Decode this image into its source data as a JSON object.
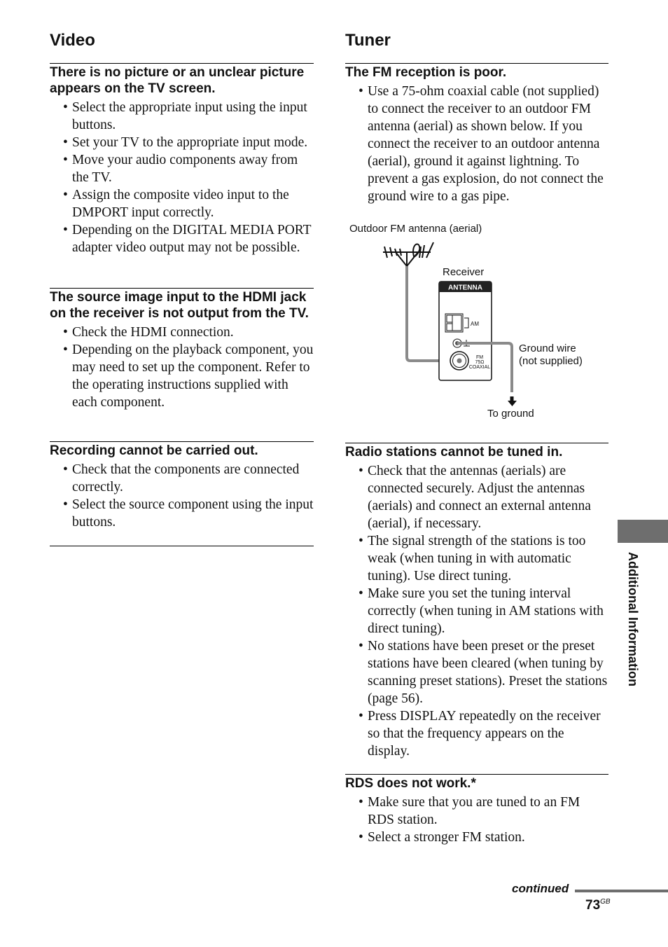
{
  "left": {
    "section_title": "Video",
    "blocks": [
      {
        "title": "There is no picture or an unclear picture appears on the TV screen.",
        "items": [
          "Select the appropriate input using the input buttons.",
          "Set your TV to the appropriate input mode.",
          "Move your audio components away from the TV.",
          "Assign the composite video input to the DMPORT input correctly.",
          "Depending on the DIGITAL MEDIA PORT adapter video output may not be possible."
        ]
      },
      {
        "title": "The source image input to the HDMI jack on the receiver is not output from the TV.",
        "items": [
          "Check the HDMI connection.",
          "Depending on the playback component, you may need to set up the component. Refer to the operating instructions supplied with each component."
        ]
      },
      {
        "title": "Recording cannot be carried out.",
        "items": [
          "Check that the components are connected correctly.",
          "Select the source component using the input buttons."
        ]
      }
    ]
  },
  "right": {
    "section_title": "Tuner",
    "blocks": [
      {
        "title": "The FM reception is poor.",
        "items": [
          "Use a 75-ohm coaxial cable (not supplied) to connect the receiver to an outdoor FM antenna (aerial) as shown below. If you connect the receiver to an outdoor antenna (aerial), ground it against lightning. To prevent a gas explosion, do not connect the ground wire to a gas pipe."
        ]
      },
      {
        "title": "Radio stations cannot be tuned in.",
        "items": [
          "Check that the antennas (aerials) are connected securely. Adjust the antennas (aerials) and connect an external antenna (aerial), if necessary.",
          "The signal strength of the stations is too weak (when tuning in with automatic tuning). Use direct tuning.",
          "Make sure you set the tuning interval correctly (when tuning in AM stations with direct tuning).",
          "No stations have been preset or the preset stations have been cleared (when tuning by scanning preset stations). Preset the stations (page 56).",
          "Press DISPLAY repeatedly on the receiver so that the frequency appears on the display."
        ]
      },
      {
        "title": "RDS does not work.*",
        "items": [
          "Make sure that you are tuned to an FM RDS station.",
          "Select a stronger FM station."
        ]
      }
    ]
  },
  "diagram": {
    "outdoor_label": "Outdoor FM antenna (aerial)",
    "receiver_label": "Receiver",
    "panel_header": "ANTENNA",
    "am_label": "AM",
    "fm_label_1": "FM",
    "fm_label_2": "75Ω",
    "fm_label_3": "COAXIAL",
    "ground_label_1": "Ground wire",
    "ground_label_2": "(not supplied)",
    "to_ground_label": "To ground"
  },
  "side_tab_label": "Additional Information",
  "footer": {
    "continued": "continued",
    "page_number": "73",
    "page_suffix": "GB"
  },
  "colors": {
    "tab_gray": "#6e6e6e",
    "wire_gray": "#8a8a8a"
  }
}
